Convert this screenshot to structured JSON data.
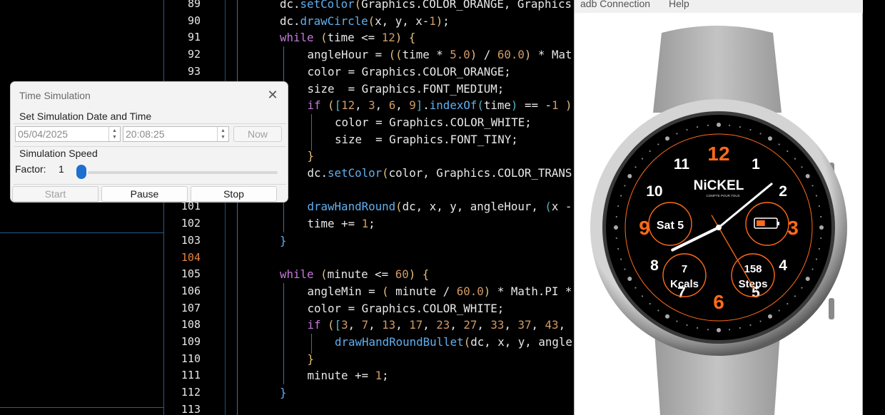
{
  "editor": {
    "line_numbers": [
      "89",
      "90",
      "91",
      "92",
      "93",
      "",
      "",
      "",
      "",
      "",
      "",
      "",
      "101",
      "102",
      "103",
      "104",
      "105",
      "106",
      "107",
      "108",
      "109",
      "110",
      "111",
      "112",
      "113"
    ],
    "active_line": "104",
    "lines": [
      {
        "indent": 2,
        "tokens": [
          [
            "t",
            "dc."
          ],
          [
            "f",
            "setColor"
          ],
          [
            "p",
            "("
          ],
          [
            "t",
            "Graphics.COLOR_ORANGE, Graphics"
          ]
        ]
      },
      {
        "indent": 2,
        "tokens": [
          [
            "t",
            "dc."
          ],
          [
            "f",
            "drawCircle"
          ],
          [
            "p",
            "("
          ],
          [
            "t",
            "x, y, x-"
          ],
          [
            "n",
            "1"
          ],
          [
            "p",
            ")"
          ],
          [
            "t",
            ";"
          ]
        ]
      },
      {
        "indent": 2,
        "tokens": [
          [
            "k",
            "while"
          ],
          [
            "t",
            " "
          ],
          [
            "p",
            "("
          ],
          [
            "t",
            "time <= "
          ],
          [
            "n",
            "12"
          ],
          [
            "p",
            ")"
          ],
          [
            "t",
            " "
          ],
          [
            "p",
            "{"
          ]
        ]
      },
      {
        "indent": 3,
        "tokens": [
          [
            "t",
            "angleHour = "
          ],
          [
            "p",
            "(("
          ],
          [
            "t",
            "time * "
          ],
          [
            "n",
            "5.0"
          ],
          [
            "p",
            ")"
          ],
          [
            "t",
            " / "
          ],
          [
            "n",
            "60.0"
          ],
          [
            "p",
            ")"
          ],
          [
            "t",
            " * Mat"
          ]
        ]
      },
      {
        "indent": 3,
        "tokens": [
          [
            "t",
            "color = Graphics.COLOR_ORANGE;"
          ]
        ]
      },
      {
        "indent": 3,
        "tokens": [
          [
            "t",
            "size  = Graphics.FONT_MEDIUM;"
          ]
        ]
      },
      {
        "indent": 3,
        "tokens": [
          [
            "k",
            "if"
          ],
          [
            "t",
            " "
          ],
          [
            "p",
            "("
          ],
          [
            "b",
            "["
          ],
          [
            "n",
            "12"
          ],
          [
            "t",
            ", "
          ],
          [
            "n",
            "3"
          ],
          [
            "t",
            ", "
          ],
          [
            "n",
            "6"
          ],
          [
            "t",
            ", "
          ],
          [
            "n",
            "9"
          ],
          [
            "b",
            "]"
          ],
          [
            "t",
            "."
          ],
          [
            "f",
            "indexOf"
          ],
          [
            "b",
            "("
          ],
          [
            "t",
            "time"
          ],
          [
            "b",
            ")"
          ],
          [
            "t",
            " == -"
          ],
          [
            "n",
            "1"
          ],
          [
            "t",
            " "
          ],
          [
            "p",
            ")"
          ]
        ]
      },
      {
        "indent": 4,
        "tokens": [
          [
            "t",
            "color = Graphics.COLOR_WHITE;"
          ]
        ]
      },
      {
        "indent": 4,
        "tokens": [
          [
            "t",
            "size  = Graphics.FONT_TINY;"
          ]
        ]
      },
      {
        "indent": 3,
        "tokens": [
          [
            "p",
            "}"
          ]
        ]
      },
      {
        "indent": 3,
        "tokens": [
          [
            "t",
            "dc."
          ],
          [
            "f",
            "setColor"
          ],
          [
            "p",
            "("
          ],
          [
            "t",
            "color, Graphics.COLOR_TRANS"
          ]
        ]
      },
      {
        "indent": 0,
        "tokens": []
      },
      {
        "indent": 3,
        "tokens": [
          [
            "f",
            "drawHandRound"
          ],
          [
            "p",
            "("
          ],
          [
            "t",
            "dc, x, y, angleHour, "
          ],
          [
            "b",
            "("
          ],
          [
            "t",
            "x -"
          ]
        ]
      },
      {
        "indent": 3,
        "tokens": [
          [
            "t",
            "time += "
          ],
          [
            "n",
            "1"
          ],
          [
            "t",
            ";"
          ]
        ]
      },
      {
        "indent": 2,
        "tokens": [
          [
            "f",
            "}"
          ]
        ]
      },
      {
        "indent": 0,
        "tokens": []
      },
      {
        "indent": 2,
        "tokens": [
          [
            "k",
            "while"
          ],
          [
            "t",
            " "
          ],
          [
            "p",
            "("
          ],
          [
            "t",
            "minute <= "
          ],
          [
            "n",
            "60"
          ],
          [
            "p",
            ")"
          ],
          [
            "t",
            " "
          ],
          [
            "p",
            "{"
          ]
        ]
      },
      {
        "indent": 3,
        "tokens": [
          [
            "t",
            "angleMin = "
          ],
          [
            "p",
            "("
          ],
          [
            "t",
            " minute / "
          ],
          [
            "n",
            "60.0"
          ],
          [
            "p",
            ")"
          ],
          [
            "t",
            " * Math.PI *"
          ]
        ]
      },
      {
        "indent": 3,
        "tokens": [
          [
            "t",
            "color = Graphics.COLOR_WHITE;"
          ]
        ]
      },
      {
        "indent": 3,
        "tokens": [
          [
            "k",
            "if"
          ],
          [
            "t",
            " "
          ],
          [
            "p",
            "("
          ],
          [
            "b",
            "["
          ],
          [
            "n",
            "3"
          ],
          [
            "t",
            ", "
          ],
          [
            "n",
            "7"
          ],
          [
            "t",
            ", "
          ],
          [
            "n",
            "13"
          ],
          [
            "t",
            ", "
          ],
          [
            "n",
            "17"
          ],
          [
            "t",
            ", "
          ],
          [
            "n",
            "23"
          ],
          [
            "t",
            ", "
          ],
          [
            "n",
            "27"
          ],
          [
            "t",
            ", "
          ],
          [
            "n",
            "33"
          ],
          [
            "t",
            ", "
          ],
          [
            "n",
            "37"
          ],
          [
            "t",
            ", "
          ],
          [
            "n",
            "43"
          ],
          [
            "t",
            ","
          ]
        ]
      },
      {
        "indent": 4,
        "tokens": [
          [
            "f",
            "drawHandRoundBullet"
          ],
          [
            "p",
            "("
          ],
          [
            "t",
            "dc, x, y, angle"
          ]
        ]
      },
      {
        "indent": 3,
        "tokens": [
          [
            "p",
            "}"
          ]
        ]
      },
      {
        "indent": 3,
        "tokens": [
          [
            "t",
            "minute += "
          ],
          [
            "n",
            "1"
          ],
          [
            "t",
            ";"
          ]
        ]
      },
      {
        "indent": 2,
        "tokens": [
          [
            "f",
            "}"
          ]
        ]
      },
      {
        "indent": 0,
        "tokens": []
      }
    ]
  },
  "dialog": {
    "title": "Time Simulation",
    "close_icon": "close-icon",
    "date_time_group": "Set Simulation Date and Time",
    "date_value": "05/04/2025",
    "time_value": "20:08:25",
    "now_label": "Now",
    "speed_group": "Simulation Speed",
    "factor_label": "Factor:",
    "factor_value": "1",
    "slider_fraction": 0,
    "start_label": "Start",
    "pause_label": "Pause",
    "stop_label": "Stop"
  },
  "emulator": {
    "menu": [
      "adb Connection",
      "Help"
    ],
    "watch": {
      "brand": "NiCKEL",
      "tagline": "COMPTE POUR TOUS",
      "date_text": "Sat 5",
      "kcal_value": "7",
      "kcal_label": "Kcals",
      "steps_value": "158",
      "steps_label": "Steps",
      "battery_fraction": 0.45,
      "hour_numerals": [
        "12",
        "1",
        "2",
        "3",
        "4",
        "5",
        "6",
        "7",
        "8",
        "9",
        "10",
        "11"
      ],
      "accent_color": "#ff6a1a",
      "time_shown": {
        "hour": 8,
        "minute": 8,
        "second": 25
      }
    }
  }
}
